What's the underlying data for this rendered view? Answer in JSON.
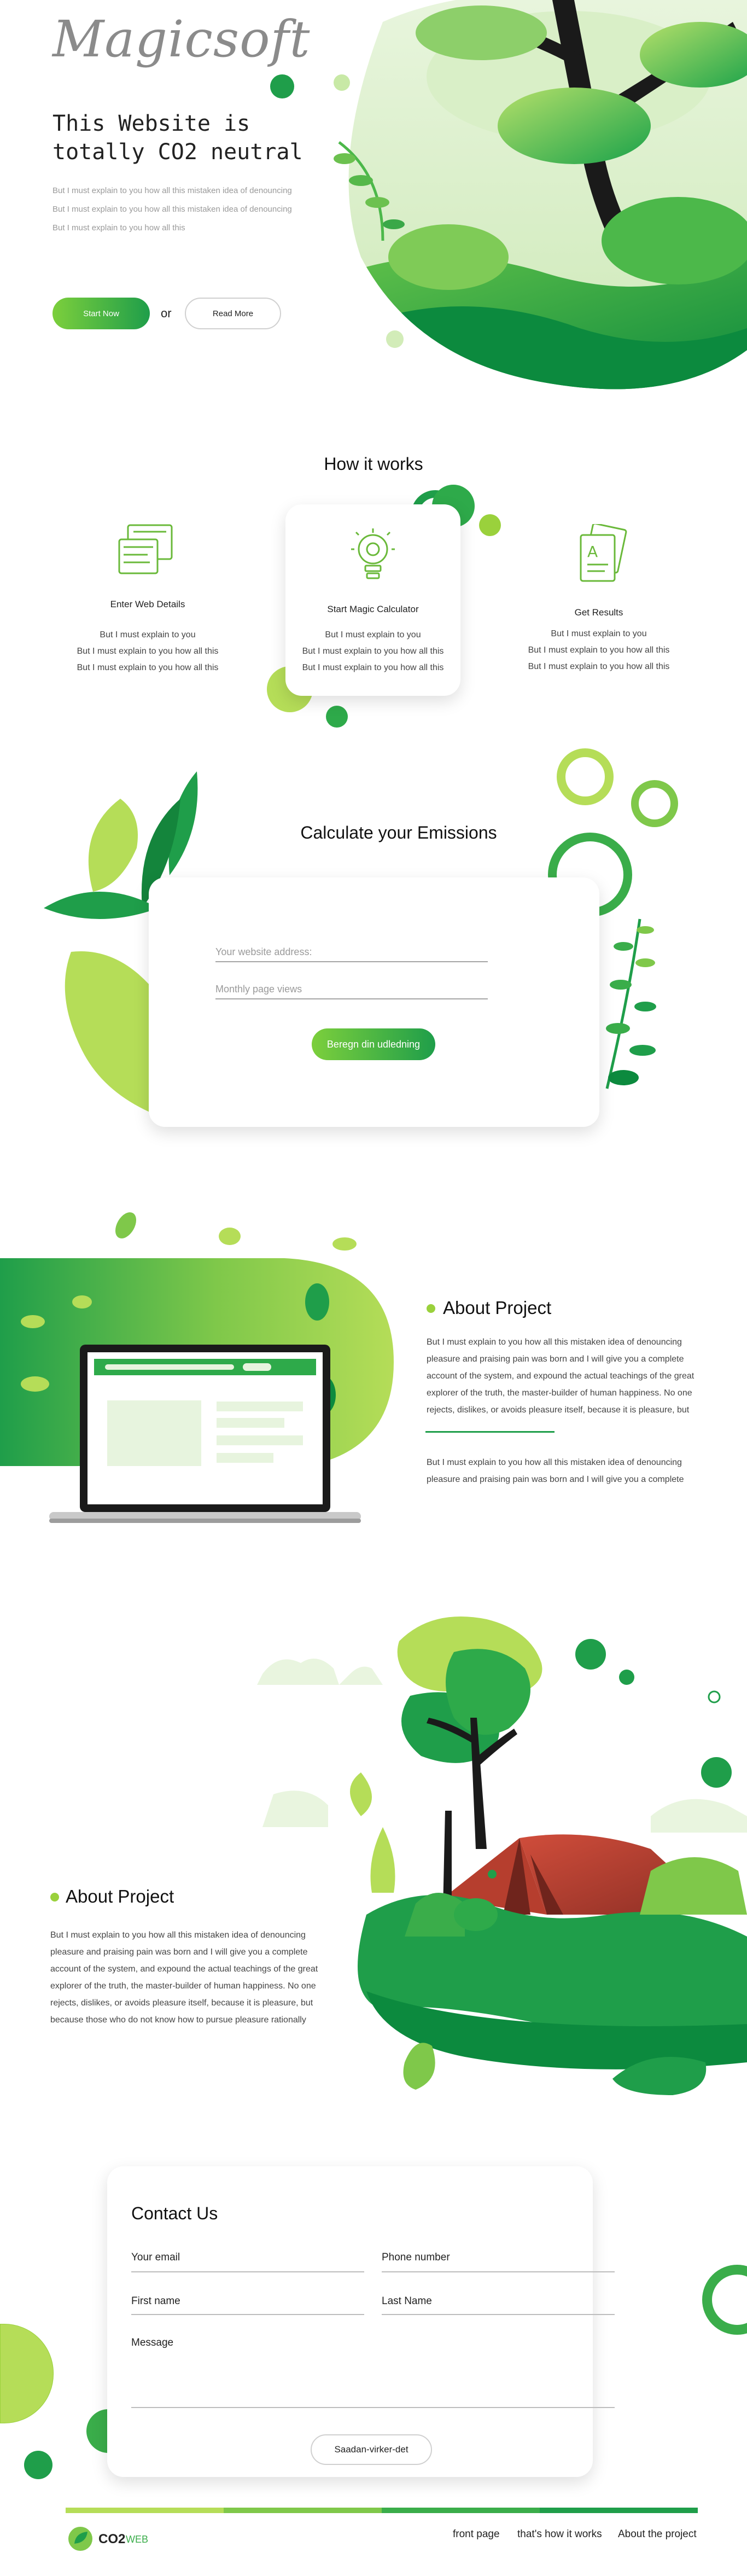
{
  "brand": {
    "name": "Magicsoft"
  },
  "hero": {
    "title": "This Website is totally CO2 neutral",
    "lines": [
      "But I must explain to you how all this mistaken idea of denouncing",
      "But I must explain to you how all this mistaken idea of denouncing",
      "But I must explain to you how all this"
    ],
    "start_label": "Start Now",
    "or_label": "or",
    "read_label": "Read More"
  },
  "how": {
    "title": "How it works",
    "steps": [
      {
        "title": "Enter Web Details",
        "lines": [
          "But I must explain to you",
          "But I must explain to you how all this",
          "But I must explain to you how all this"
        ]
      },
      {
        "title": "Start Magic Calculator",
        "lines": [
          "But I must explain to you",
          "But I must explain to you how all this",
          "But I must explain to you how all this"
        ]
      },
      {
        "title": "Get Results",
        "lines": [
          "But I must explain to you",
          "But I must explain to you how all this",
          "But I must explain to you how all this"
        ]
      }
    ]
  },
  "calc": {
    "title": "Calculate your Emissions",
    "website_placeholder": "Your website address:",
    "views_placeholder": "Monthly page views",
    "submit_label": "Beregn din udledning"
  },
  "about1": {
    "title": "About Project",
    "lines": [
      "But I must explain to you how all this mistaken idea of denouncing",
      "pleasure and praising pain was born and I will give you a complete",
      "account of the system, and expound the actual teachings of the great",
      "explorer of the truth, the master-builder of human happiness. No one",
      "rejects, dislikes, or avoids pleasure itself, because it is pleasure, but"
    ],
    "lines2": [
      "But I must explain to you how all this mistaken idea of denouncing",
      "pleasure and praising pain was born and I will give you a complete"
    ]
  },
  "about2": {
    "title": "About Project",
    "lines": [
      "But I must explain to you how all this mistaken idea of denouncing",
      "pleasure and praising pain was born and I will give you a complete",
      "account of the system, and expound the actual teachings of the great",
      "explorer of the truth, the master-builder of human happiness. No one",
      "rejects, dislikes, or avoids pleasure itself, because it is pleasure, but",
      "because those who do not know how to pursue pleasure rationally"
    ]
  },
  "contact": {
    "title": "Contact Us",
    "email_label": "Your email",
    "phone_label": "Phone number",
    "first_label": "First name",
    "last_label": "Last Name",
    "message_label": "Message",
    "submit_label": "Saadan-virker-det"
  },
  "footer": {
    "logo_text": "CO2",
    "logo_sub": "WEB",
    "links": [
      "front page",
      "that's how it works",
      "About the project"
    ]
  },
  "colors": {
    "accent": "#1f9e4a",
    "lime": "#9ad13c",
    "dark_green": "#0b7a3b"
  }
}
